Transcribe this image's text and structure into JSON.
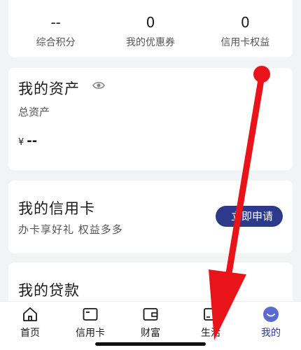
{
  "stats": [
    {
      "value": "--",
      "label": "综合积分"
    },
    {
      "value": "0",
      "label": "我的优惠券"
    },
    {
      "value": "0",
      "label": "信用卡权益"
    }
  ],
  "assets": {
    "title": "我的资产",
    "subtitle": "总资产",
    "currency": "¥",
    "value": "--"
  },
  "credit": {
    "title": "我的信用卡",
    "subtitle": "办卡享好礼 权益多多",
    "apply_label": "立即申请"
  },
  "loan": {
    "title": "我的贷款"
  },
  "tabbar": [
    {
      "label": "首页",
      "icon": "home-icon"
    },
    {
      "label": "信用卡",
      "icon": "credit-card-icon"
    },
    {
      "label": "财富",
      "icon": "wallet-icon"
    },
    {
      "label": "生活",
      "icon": "cup-icon"
    },
    {
      "label": "我的",
      "icon": "profile-icon",
      "active": true
    }
  ],
  "colors": {
    "accent": "#2d3a8c",
    "annotation": "#e8141a",
    "background": "#f2f3f5"
  }
}
